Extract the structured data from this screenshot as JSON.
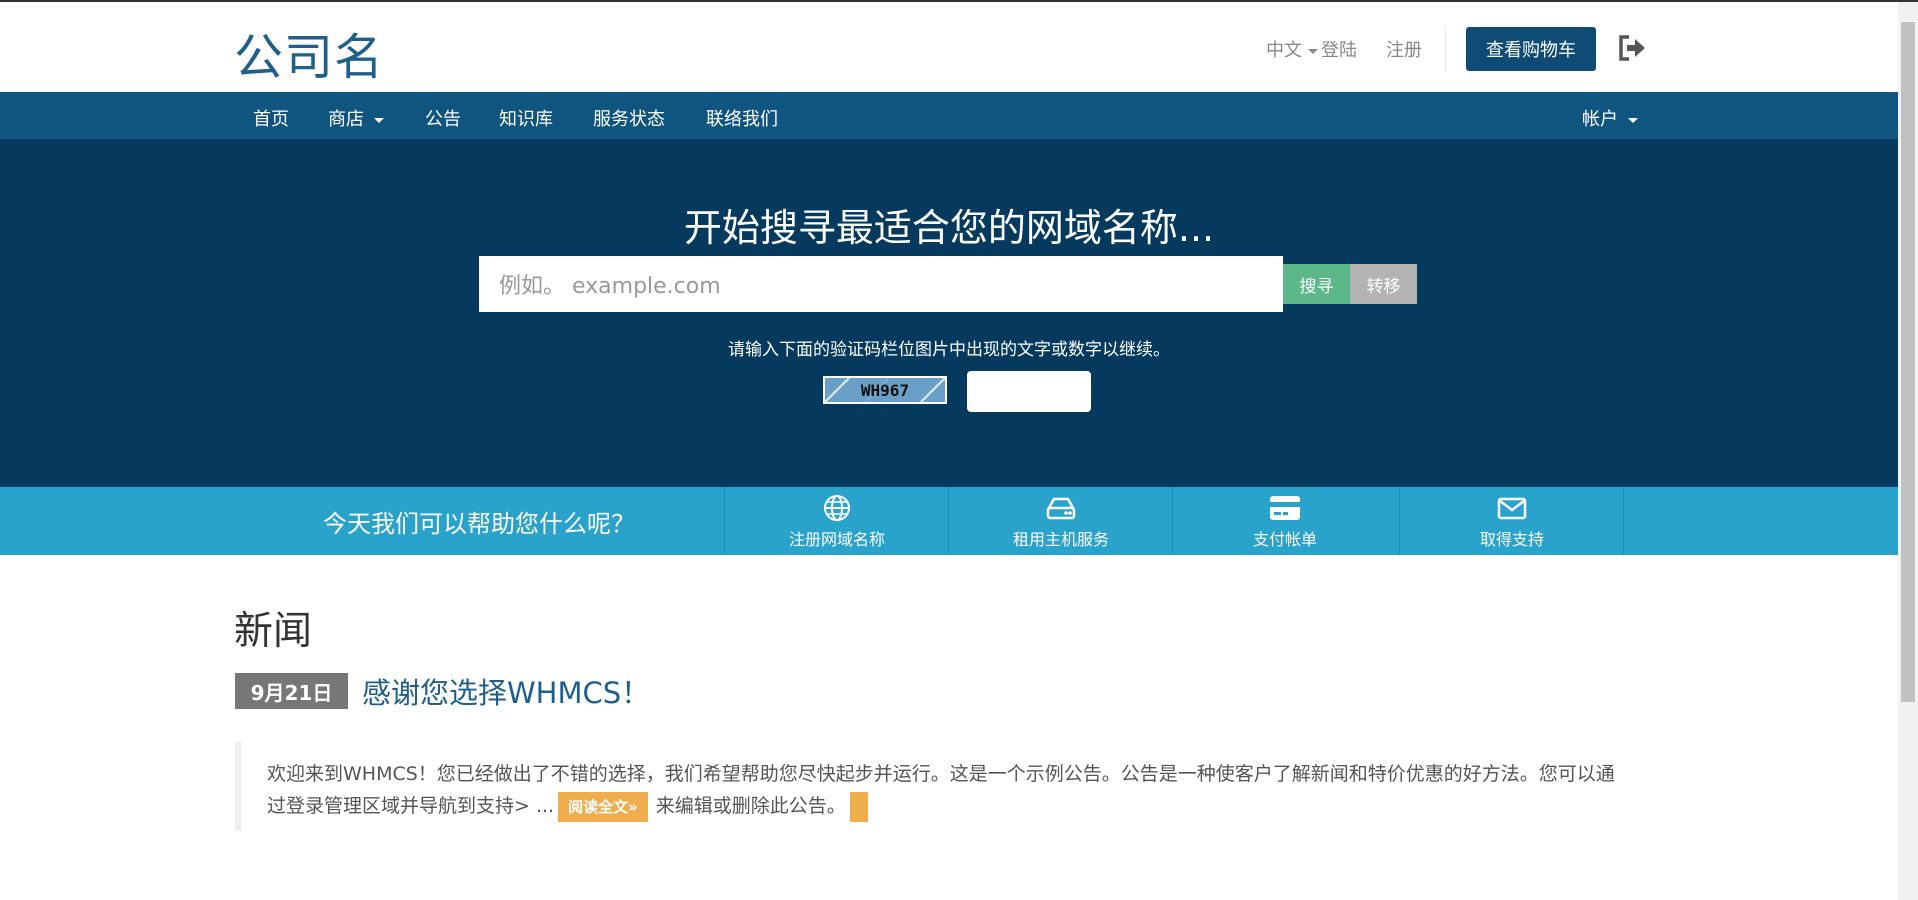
{
  "header": {
    "logo": "公司名",
    "language": "中文",
    "login": "登陆",
    "register": "注册",
    "cart_button": "查看购物车"
  },
  "nav": {
    "items": [
      "首页",
      "商店",
      "公告",
      "知识库",
      "服务状态",
      "联络我们"
    ],
    "account": "帐户"
  },
  "hero": {
    "title": "开始搜寻最适合您的网域名称...",
    "search_placeholder": "例如。 example.com",
    "search_button": "搜寻",
    "transfer_button": "转移",
    "captcha_prompt": "请输入下面的验证码栏位图片中出现的文字或数字以继续。",
    "captcha_code": "WH967"
  },
  "helpbar": {
    "question": "今天我们可以帮助您什么呢？",
    "items": [
      {
        "label": "注册网域名称",
        "icon": "globe-icon"
      },
      {
        "label": "租用主机服务",
        "icon": "server-icon"
      },
      {
        "label": "支付帐单",
        "icon": "credit-card-icon"
      },
      {
        "label": "取得支持",
        "icon": "envelope-icon"
      }
    ]
  },
  "news": {
    "title": "新闻",
    "date": "9月21日",
    "headline": "感谢您选择WHMCS！",
    "body_start": "欢迎来到WHMCS！您已经做出了不错的选择，我们希望帮助您尽快起步并运行。这是一个示例公告。公告是一种使客户了解新闻和特价优惠的好方法。您可以通过登录管理区域并导航到支持> ...",
    "read_more": "阅读全文»",
    "body_end": "来编辑或删除此公告。"
  },
  "colors": {
    "header_blue": "#0e4b75",
    "nav_blue": "#10557f",
    "hero_blue": "#053a5e",
    "helpbar_cyan": "#29a3cc",
    "search_green": "#5cb888",
    "read_more_orange": "#f0ad4e"
  }
}
